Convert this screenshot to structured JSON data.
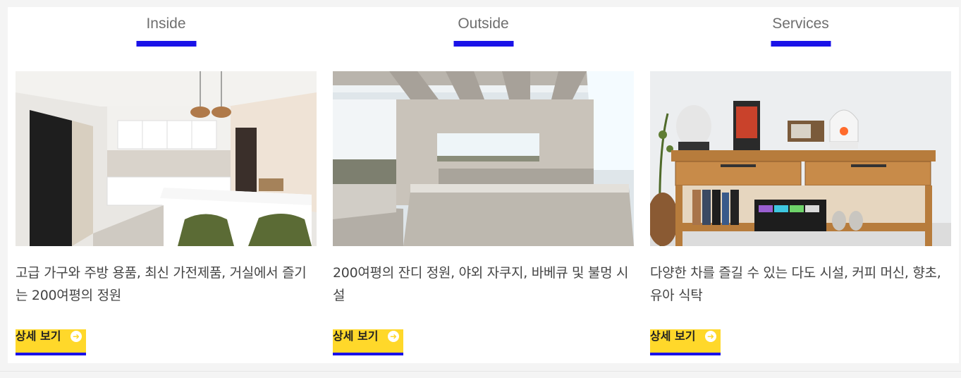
{
  "cards": [
    {
      "tab_label": "Inside",
      "description": "고급 가구와 주방 용품,  최신 가전제품, 거실에서 즐기는 200여평의 정원",
      "button_label": "상세 보기",
      "image_subject": "interior-kitchen"
    },
    {
      "tab_label": "Outside",
      "description": "200여평의 잔디 정원, 야외 자쿠지, 바베큐  및 불멍 시설",
      "button_label": "상세 보기",
      "image_subject": "outdoor-jacuzzi"
    },
    {
      "tab_label": "Services",
      "description": "다양한 차를 즐길 수 있는 다도 시설, 커피 머신, 향초, 유아 식탁",
      "button_label": "상세 보기",
      "image_subject": "tea-station"
    }
  ],
  "colors": {
    "accent": "#1a12e8",
    "button": "#ffd82a",
    "tab_text": "#6f6f6f",
    "body_text": "#444444"
  },
  "icons": {
    "button_icon": "arrow-right-circle-icon"
  }
}
